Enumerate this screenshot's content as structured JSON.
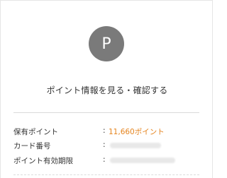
{
  "logo": {
    "letter": "P",
    "color": "#7a7a7a"
  },
  "link": {
    "label": "ポイント情報を見る・確認する"
  },
  "rows": [
    {
      "label": "保有ポイント",
      "separator": ":",
      "value": "11,660ポイント",
      "value_color": "#e5841e"
    },
    {
      "label": "カード番号",
      "separator": ":"
    },
    {
      "label": "ポイント有効期限",
      "separator": ":"
    }
  ]
}
